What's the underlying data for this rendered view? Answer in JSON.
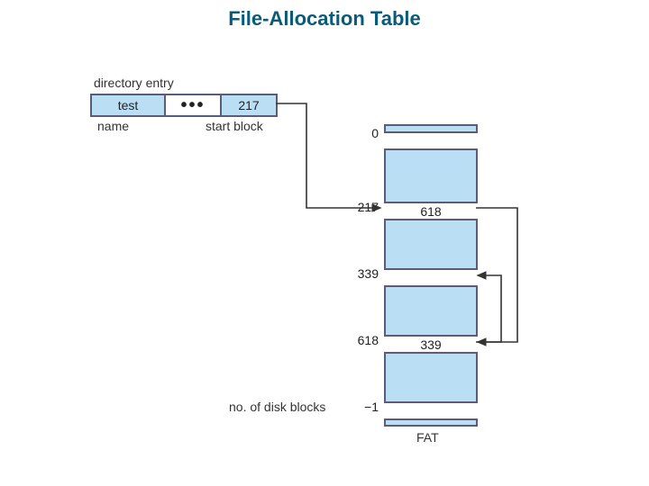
{
  "title": "File-Allocation Table",
  "labels": {
    "directory_entry": "directory entry",
    "name": "name",
    "start_block": "start block",
    "no_disk_blocks": "no. of disk blocks",
    "fat": "FAT"
  },
  "directory": {
    "filename": "test",
    "start_block": "217"
  },
  "fat": {
    "indices": {
      "top": "0",
      "i217": "217",
      "i339": "339",
      "i618": "618",
      "last": "−1"
    },
    "values": {
      "v217": "618",
      "v339": "",
      "v618": "339"
    }
  }
}
